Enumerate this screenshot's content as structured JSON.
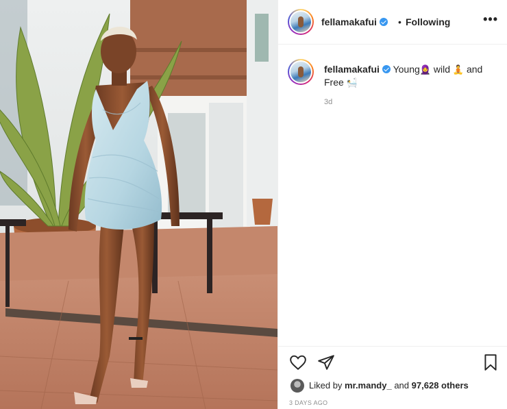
{
  "post": {
    "username": "fellamakafui",
    "separator": "•",
    "follow_status": "Following",
    "more_label": "•••",
    "caption": {
      "username": "fellamakafui",
      "part1": "Young",
      "emoji1": "🧕",
      "part2": "wild",
      "emoji2": "🧘",
      "part3": "and Free",
      "emoji3": "🛀"
    },
    "age": "3d",
    "likes": {
      "prefix": "Liked by",
      "user": "mr.mandy_",
      "middle": "and",
      "count": "97,628 others"
    },
    "date": "3 DAYS AGO"
  },
  "icons": {
    "heart": "heart-icon",
    "share": "send-icon",
    "save": "bookmark-icon",
    "verified": "verified-badge-icon",
    "more": "more-icon"
  },
  "colors": {
    "verified": "#3897f0",
    "text": "#262626",
    "muted": "#8e8e8e",
    "border": "#efefef"
  }
}
